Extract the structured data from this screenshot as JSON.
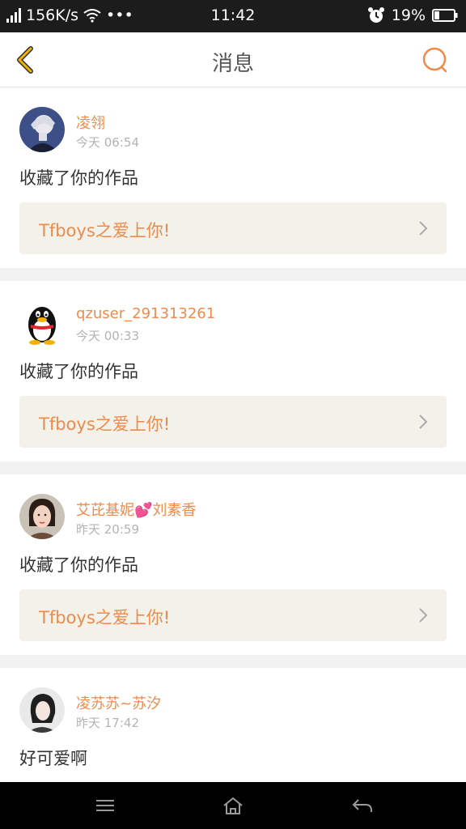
{
  "status_bar": {
    "speed": "156K/s",
    "dots": "•••",
    "time": "11:42",
    "battery": "19%"
  },
  "header": {
    "title": "消息"
  },
  "messages": [
    {
      "user": "凌翎",
      "time": "今天 06:54",
      "text": "收藏了你的作品",
      "work": "Tfboys之爱上你!",
      "avatar": "anime-avatar"
    },
    {
      "user": "qzuser_291313261",
      "time": "今天 00:33",
      "text": "收藏了你的作品",
      "work": "Tfboys之爱上你!",
      "avatar": "penguin-avatar"
    },
    {
      "user_prefix": "艾芘基妮",
      "user_emoji": "💕",
      "user_suffix": "刘素香",
      "time": "昨天 20:59",
      "text": "收藏了你的作品",
      "work": "Tfboys之爱上你!",
      "avatar": "woman-avatar"
    },
    {
      "user": "凌苏苏~苏汐",
      "time": "昨天 17:42",
      "text": "好可爱啊",
      "avatar": "girl-avatar"
    }
  ],
  "colors": {
    "accent": "#f08a4b",
    "back_arrow": "#f0b400",
    "work_bg": "#f3f2ea"
  }
}
